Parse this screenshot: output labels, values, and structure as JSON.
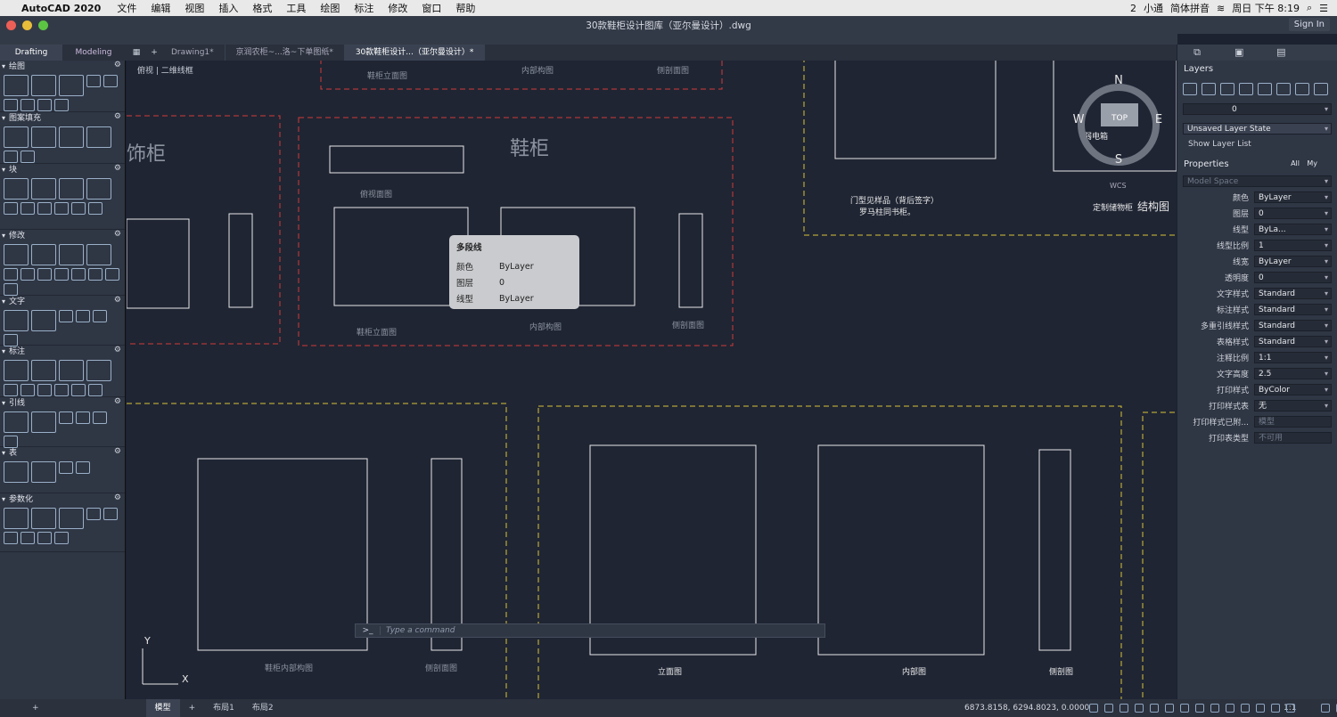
{
  "menubar": {
    "app": "AutoCAD 2020",
    "items": [
      "文件",
      "编辑",
      "视图",
      "插入",
      "格式",
      "工具",
      "绘图",
      "标注",
      "修改",
      "窗口",
      "帮助"
    ],
    "right": {
      "badge": "2",
      "user": "小通",
      "ime": "简体拼音",
      "clock": "周日 下午 8:19"
    }
  },
  "window": {
    "title": "30款鞋柜设计图库（亚尔曼设计）.dwg",
    "signin": "Sign In"
  },
  "workspace_tabs": [
    "Drafting",
    "Modeling"
  ],
  "doc_tabs": [
    "Drawing1*",
    "京润农柜~...洛~下单图纸*",
    "30款鞋柜设计...（亚尔曼设计）*"
  ],
  "view_label": "俯视 | 二维线框",
  "tool_sections": [
    "绘图",
    "图案填充",
    "块",
    "修改",
    "文字",
    "标注",
    "引线",
    "表",
    "参数化"
  ],
  "canvas": {
    "labels": [
      "鞋柜立面图",
      "内部构图",
      "侧剖面图",
      "饰柜",
      "鞋柜",
      "俯视面图",
      "鞋柜立面图",
      "内部构图",
      "侧剖面图",
      "门型见样品（背后签字）",
      "罗马柱同书柜。",
      "定制储物柜",
      "结构图",
      "鞋柜内部构图",
      "侧剖面图",
      "立面图",
      "内部图",
      "侧剖图"
    ],
    "compass": {
      "n": "N",
      "s": "S",
      "w": "W",
      "e": "E",
      "top": "TOP",
      "wcs": "WCS"
    },
    "cad_note": "弱电箱",
    "ucs": {
      "y": "Y",
      "x": "X"
    }
  },
  "tooltip": {
    "title": "多段线",
    "rows": [
      {
        "k": "颜色",
        "v": "ByLayer"
      },
      {
        "k": "图层",
        "v": "0"
      },
      {
        "k": "线型",
        "v": "ByLayer"
      }
    ]
  },
  "command": {
    "prompt": ">_",
    "placeholder": "Type a command"
  },
  "layers": {
    "title": "Layers",
    "current": "0",
    "state": "Unsaved Layer State",
    "show": "Show Layer List"
  },
  "properties": {
    "title": "Properties",
    "all": "All",
    "my": "My",
    "space": "Model Space",
    "rows": [
      {
        "k": "颜色",
        "v": "ByLayer"
      },
      {
        "k": "图层",
        "v": "0"
      },
      {
        "k": "线型",
        "v": "ByLa..."
      },
      {
        "k": "线型比例",
        "v": "1"
      },
      {
        "k": "线宽",
        "v": "ByLayer"
      },
      {
        "k": "透明度",
        "v": "0"
      },
      {
        "k": "文字样式",
        "v": "Standard"
      },
      {
        "k": "标注样式",
        "v": "Standard"
      },
      {
        "k": "多重引线样式",
        "v": "Standard"
      },
      {
        "k": "表格样式",
        "v": "Standard"
      },
      {
        "k": "注释比例",
        "v": "1:1"
      },
      {
        "k": "文字高度",
        "v": "2.5"
      },
      {
        "k": "打印样式",
        "v": "ByColor"
      },
      {
        "k": "打印样式表",
        "v": "无"
      },
      {
        "k": "打印样式已附...",
        "v": "模型"
      },
      {
        "k": "打印表类型",
        "v": "不可用"
      }
    ]
  },
  "status": {
    "tabs": [
      "模型",
      "布局1",
      "布局2"
    ],
    "coords": "6873.8158, 6294.8023, 0.0000",
    "scale": "1:1"
  },
  "colors": {
    "frame_red": "#d23a3a",
    "frame_yellow": "#d8c23a",
    "cad_white": "#e8e8e8",
    "dim_yellow": "#c9a62a"
  }
}
